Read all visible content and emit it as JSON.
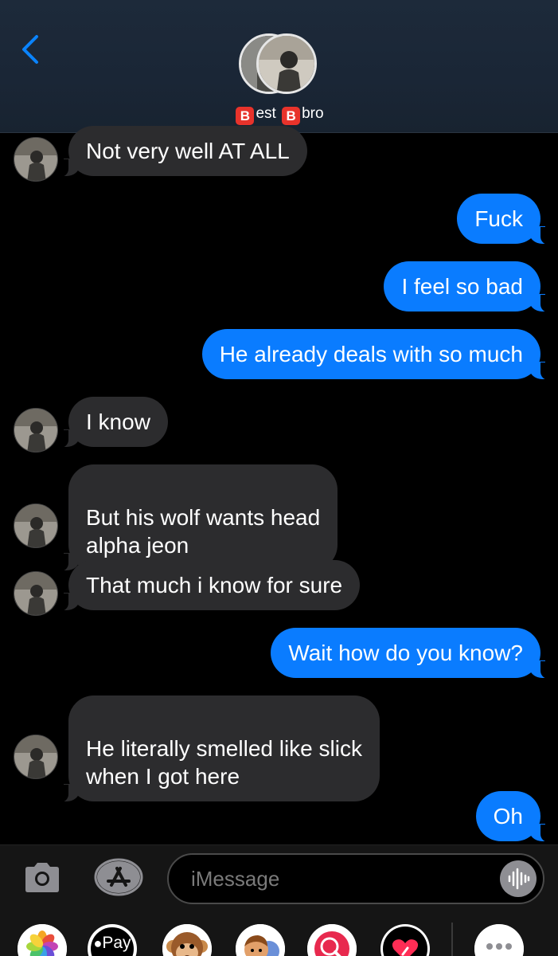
{
  "header": {
    "contact_name_part1": "est",
    "contact_name_part2": "bro",
    "emoji_letter": "B"
  },
  "messages": [
    {
      "dir": "in",
      "text": "Not very well AT ALL"
    },
    {
      "dir": "out",
      "text": "Fuck"
    },
    {
      "dir": "out",
      "text": "I feel so bad"
    },
    {
      "dir": "out",
      "text": "He already deals with so much"
    },
    {
      "dir": "in",
      "text": "I know"
    },
    {
      "dir": "in",
      "text": "But his wolf wants head\nalpha jeon"
    },
    {
      "dir": "in",
      "text": "That much i know for sure"
    },
    {
      "dir": "out",
      "text": "Wait how do you know?"
    },
    {
      "dir": "in",
      "text": "He literally smelled like slick\nwhen I got here"
    },
    {
      "dir": "out",
      "text": "Oh"
    }
  ],
  "input": {
    "placeholder": "iMessage"
  },
  "apps": {
    "apple_pay_label": "Pay"
  },
  "colors": {
    "outgoing_bubble": "#0a7cff",
    "incoming_bubble": "#2c2c2e",
    "accent": "#0a84ff"
  }
}
